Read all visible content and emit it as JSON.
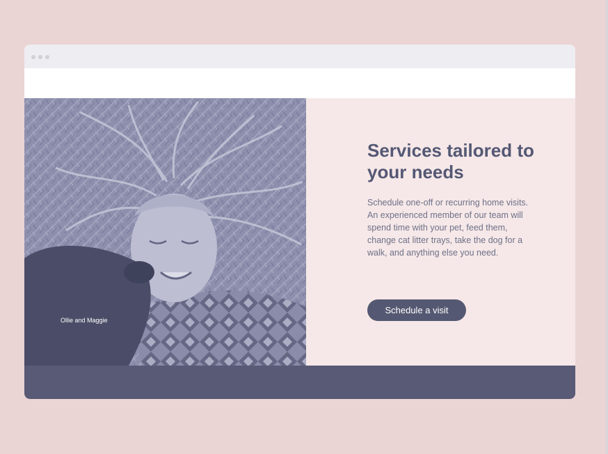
{
  "hero": {
    "caption": "Ollie and Maggie"
  },
  "content": {
    "headline": "Services tailored to your needs",
    "body": "Schedule one-off or recurring home visits. An experienced member of our team will spend time with your pet, feed them, change cat litter trays, take the dog for a walk, and anything else you need.",
    "cta_label": "Schedule a visit"
  },
  "colors": {
    "background": "#ebd4d4",
    "titlebar": "#eeedf2",
    "content_panel": "#f6e8e8",
    "headline": "#545874",
    "button": "#555872",
    "footer": "#585a76"
  }
}
